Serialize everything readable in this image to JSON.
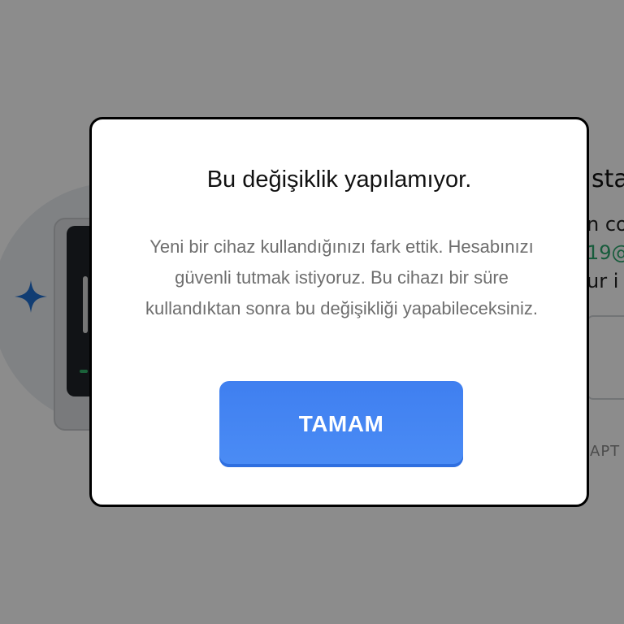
{
  "dialog": {
    "title": "Bu değişiklik yapılamıyor.",
    "message": "Yeni bir cihaz kullandığınızı fark ettik. Hesabınızı güvenli tutmak istiyoruz. Bu cihazı bir süre kullandıktan sonra bu değişikliği yapabileceksiniz.",
    "ok_label": "TAMAM",
    "button_color": "#4a86f2"
  },
  "background_page": {
    "title_fragment": "sta",
    "line1_fragment": "n co",
    "line2_fragment": "19@",
    "line3_fragment": "ur i",
    "caption_fragment": "APT",
    "accent_green": "#2aa86d",
    "sparkle_color": "#1f6fd1"
  }
}
